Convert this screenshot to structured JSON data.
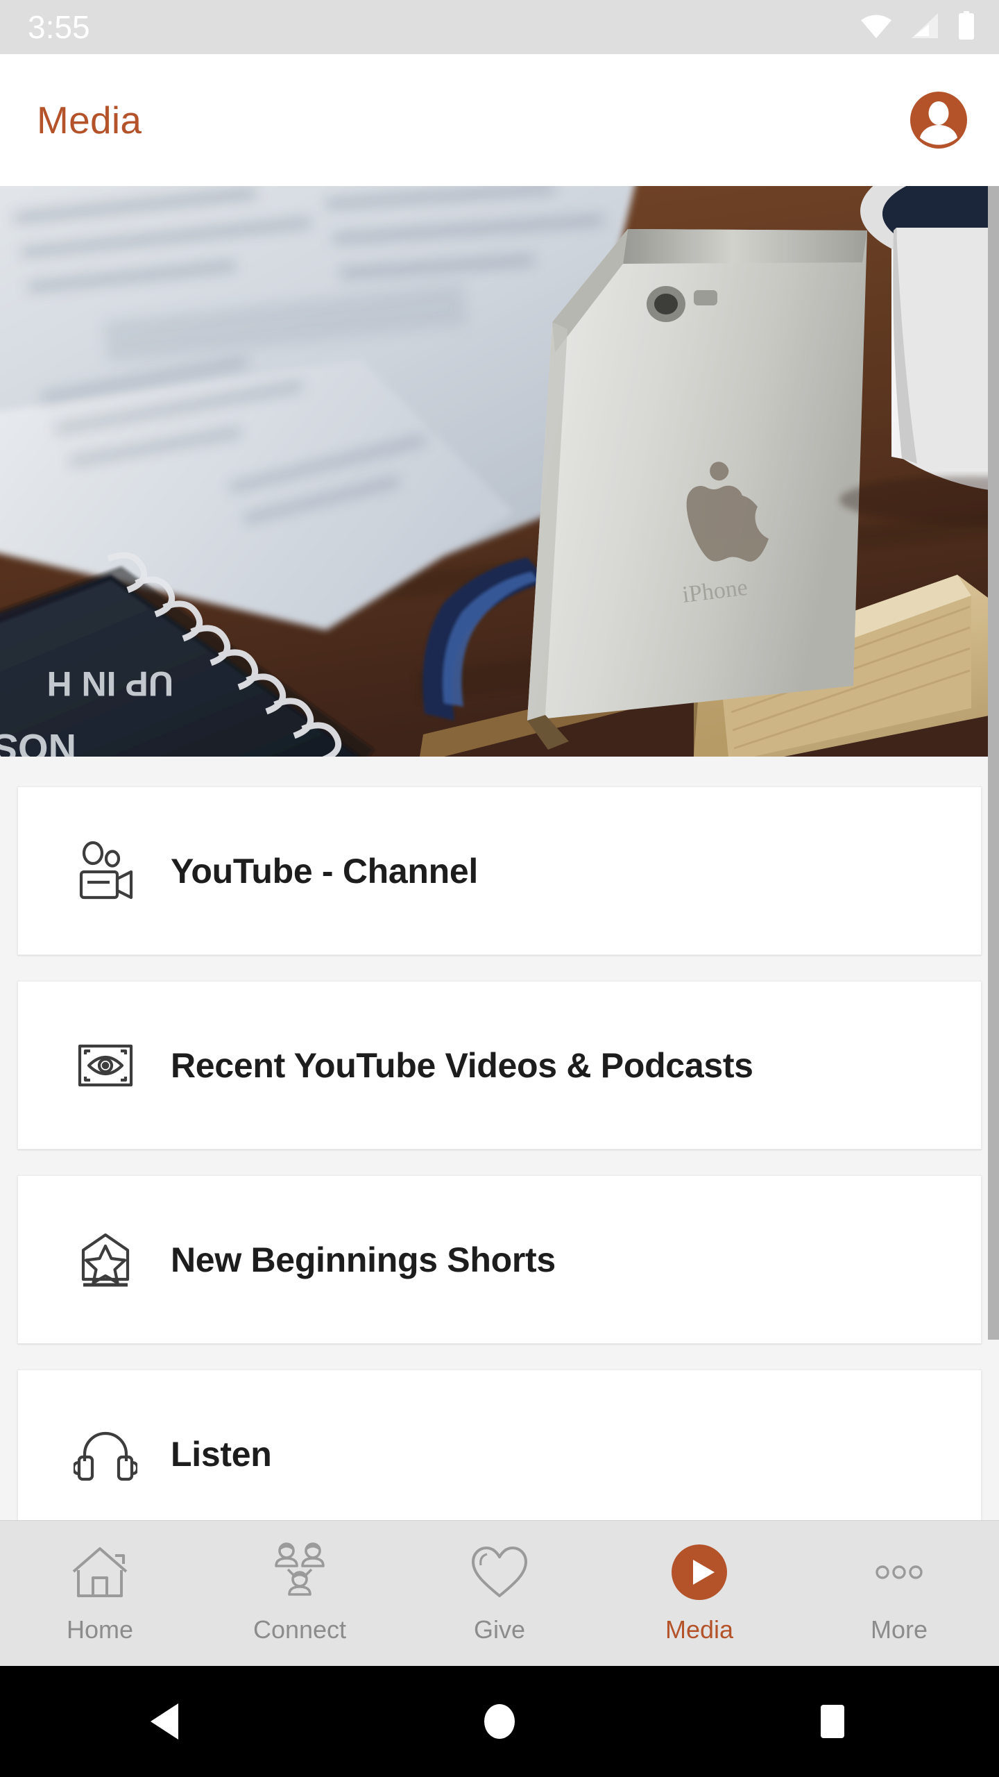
{
  "status_bar": {
    "time": "3:55",
    "icons": [
      "wifi-icon",
      "cellular-signal-icon",
      "battery-icon"
    ]
  },
  "app_bar": {
    "title": "Media",
    "account_icon": "account-circle-icon"
  },
  "hero": {
    "alt": "Silver iPhone on wooden stand beside an open book, spiral notebook and a white mug of coffee",
    "notebook_text": "NOSTALGIC UP IN H"
  },
  "colors": {
    "accent": "#b4532a",
    "page_background": "#f4f4f4",
    "card_background": "#ffffff",
    "tab_bar_background": "#e3e3e3",
    "status_bar_background": "#dedede",
    "inactive_tab_text": "#8c8c8c",
    "card_text": "#1d1d1d",
    "scrollbar": "#b2b2b2"
  },
  "menu": {
    "items": [
      {
        "label": "YouTube - Channel",
        "icon": "video-camera-people-icon"
      },
      {
        "label": "Recent YouTube Videos & Podcasts",
        "icon": "eye-frame-icon"
      },
      {
        "label": "New Beginnings Shorts",
        "icon": "star-badge-icon"
      },
      {
        "label": "Listen",
        "icon": "headphones-icon"
      }
    ]
  },
  "tab_bar": {
    "items": [
      {
        "label": "Home",
        "icon": "home-icon",
        "active": false
      },
      {
        "label": "Connect",
        "icon": "people-group-icon",
        "active": false
      },
      {
        "label": "Give",
        "icon": "heart-icon",
        "active": false
      },
      {
        "label": "Media",
        "icon": "play-circle-icon",
        "active": true
      },
      {
        "label": "More",
        "icon": "more-dots-icon",
        "active": false
      }
    ]
  },
  "android_nav": {
    "back": "back-triangle-icon",
    "home": "home-circle-icon",
    "recents": "recents-square-icon"
  }
}
